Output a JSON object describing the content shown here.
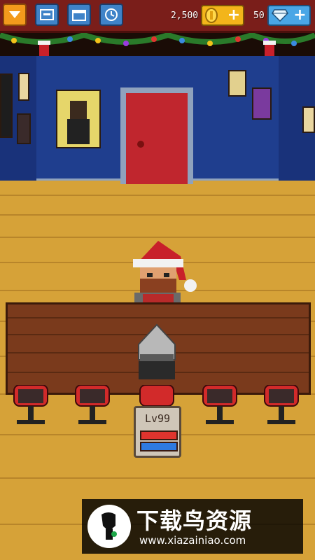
{
  "topbar": {
    "buttons": [
      {
        "icon": "dropdown-arrow-icon",
        "color": "#f39a1c"
      },
      {
        "icon": "inventory-icon",
        "color": "#3f83c8"
      },
      {
        "icon": "calendar-icon",
        "color": "#3f83c8"
      },
      {
        "icon": "clock-icon",
        "color": "#3f83c8"
      }
    ],
    "coins": {
      "value": "2,500",
      "icon": "gold-coin-icon",
      "add_icon": "plus-icon"
    },
    "gems": {
      "value": "50",
      "icon": "diamond-icon",
      "add_icon": "plus-icon"
    }
  },
  "scene": {
    "room": "bedroom with blue walls, red door, posters",
    "decoration": "christmas-garland",
    "game_master_hat": "santa-hat",
    "player_headwear": "knight-helmet"
  },
  "player_badge": {
    "level": "Lv99",
    "health_color": "#e0342e",
    "mana_color": "#2e7ae0",
    "health_fill": 1.0,
    "mana_fill": 1.0
  },
  "watermark": {
    "title": "下载鸟资源",
    "url": "www.xiazainiao.com"
  }
}
